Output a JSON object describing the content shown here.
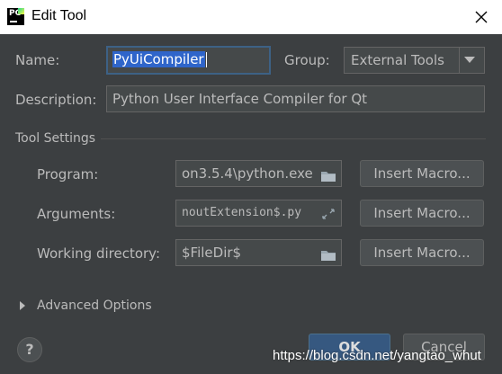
{
  "window": {
    "title": "Edit Tool",
    "app_icon_text": "PC"
  },
  "name": {
    "label": "Name:",
    "value": "PyUiCompiler"
  },
  "group": {
    "label": "Group:",
    "value": "External Tools"
  },
  "description": {
    "label": "Description:",
    "value": "Python User Interface Compiler for Qt"
  },
  "tool_settings": {
    "heading": "Tool Settings",
    "program": {
      "label": "Program:",
      "value": "оn3.5.4\\python.exe"
    },
    "arguments": {
      "label": "Arguments:",
      "value": "noutExtension$.py"
    },
    "working_directory": {
      "label": "Working directory:",
      "value": "$FileDir$"
    },
    "insert_macro_label": "Insert Macro..."
  },
  "advanced_options": {
    "label": "Advanced Options"
  },
  "footer": {
    "help_label": "?",
    "ok_label": "OK",
    "cancel_label": "Cancel"
  },
  "watermark": "https://blog.csdn.net/yangtao_whut",
  "colors": {
    "background": "#3c3f41",
    "titlebar": "#ffffff",
    "field": "#45494a",
    "selection": "#2f65ca",
    "ok_button": "#365880",
    "text": "#bbbbbb"
  }
}
